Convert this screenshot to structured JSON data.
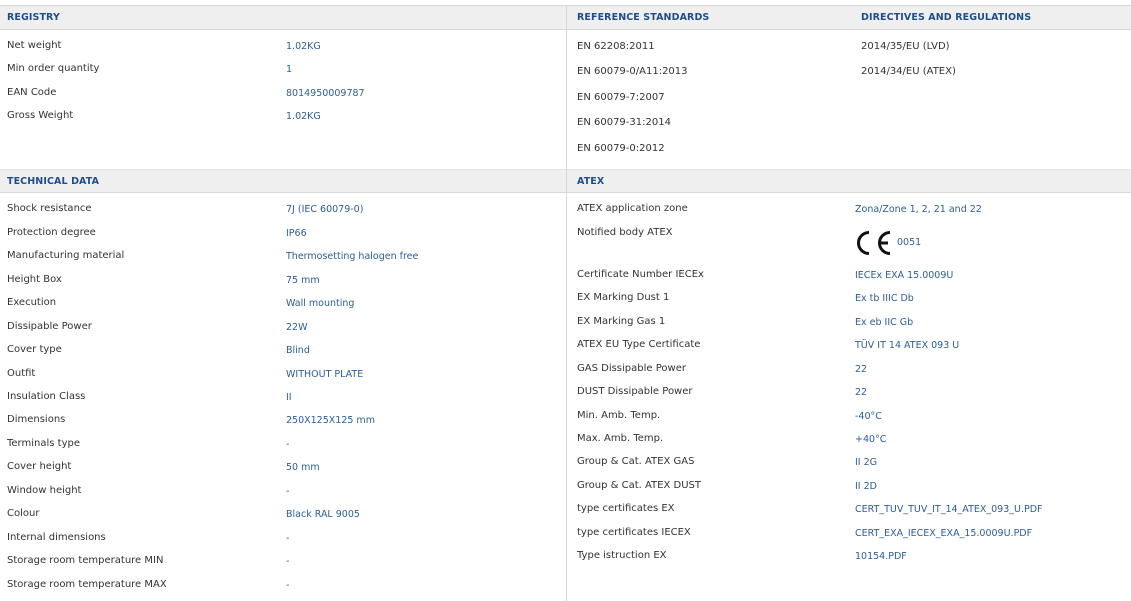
{
  "registry": {
    "title": "REGISTRY",
    "rows": [
      {
        "label": "Net weight",
        "value": "1.02KG"
      },
      {
        "label": "Min order quantity",
        "value": "1"
      },
      {
        "label": "EAN Code",
        "value": "8014950009787"
      },
      {
        "label": "Gross Weight",
        "value": "1.02KG"
      }
    ]
  },
  "reference_standards": {
    "title": "REFERENCE STANDARDS",
    "items": [
      "EN 62208:2011",
      "EN 60079-0/A11:2013",
      "EN 60079-7:2007",
      "EN 60079-31:2014",
      "EN 60079-0:2012"
    ]
  },
  "directives": {
    "title": "DIRECTIVES AND REGULATIONS",
    "items": [
      "2014/35/EU (LVD)",
      "2014/34/EU (ATEX)"
    ]
  },
  "technical_data": {
    "title": "TECHNICAL DATA",
    "rows": [
      {
        "label": "Shock resistance",
        "value": "7J (IEC 60079-0)"
      },
      {
        "label": "Protection degree",
        "value": "IP66"
      },
      {
        "label": "Manufacturing material",
        "value": "Thermosetting halogen free"
      },
      {
        "label": "Height Box",
        "value": "75 mm"
      },
      {
        "label": "Execution",
        "value": "Wall mounting"
      },
      {
        "label": "Dissipable Power",
        "value": "22W"
      },
      {
        "label": "Cover type",
        "value": "Blind"
      },
      {
        "label": "Outfit",
        "value": "WITHOUT PLATE"
      },
      {
        "label": "Insulation Class",
        "value": "II"
      },
      {
        "label": "Dimensions",
        "value": "250X125X125 mm"
      },
      {
        "label": "Terminals type",
        "value": "-"
      },
      {
        "label": "Cover height",
        "value": "50 mm"
      },
      {
        "label": "Window height",
        "value": "-"
      },
      {
        "label": "Colour",
        "value": "Black RAL 9005"
      },
      {
        "label": "Internal dimensions",
        "value": "-"
      },
      {
        "label": "Storage room temperature MIN",
        "value": "-"
      },
      {
        "label": "Storage room temperature MAX",
        "value": "-"
      }
    ]
  },
  "atex": {
    "title": "ATEX",
    "application_zone": {
      "label": "ATEX application zone",
      "value": "Zona/Zone 1, 2, 21 and 22"
    },
    "notified_body": {
      "label": "Notified body ATEX",
      "mark_text": "CE",
      "code": "0051"
    },
    "rows": [
      {
        "label": "Certificate Number IECEx",
        "value": "IECEx EXA 15.0009U"
      },
      {
        "label": "EX Marking Dust 1",
        "value": "Ex tb IIIC Db"
      },
      {
        "label": "EX Marking Gas 1",
        "value": "Ex eb IIC Gb"
      },
      {
        "label": "ATEX EU Type Certificate",
        "value": "TÜV IT 14 ATEX 093 U"
      },
      {
        "label": "GAS Dissipable Power",
        "value": "22"
      },
      {
        "label": "DUST Dissipable Power",
        "value": "22"
      },
      {
        "label": "Min. Amb. Temp.",
        "value": "-40°C"
      },
      {
        "label": "Max. Amb. Temp.",
        "value": "+40°C"
      },
      {
        "label": "Group & Cat. ATEX GAS",
        "value": "II 2G"
      },
      {
        "label": "Group & Cat. ATEX DUST",
        "value": "II 2D"
      },
      {
        "label": "type certificates EX",
        "value": "CERT_TUV_TUV_IT_14_ATEX_093_U.PDF"
      },
      {
        "label": "type certificates IECEX",
        "value": "CERT_EXA_IECEX_EXA_15.0009U.PDF"
      },
      {
        "label": "Type istruction EX",
        "value": "10154.PDF"
      }
    ]
  }
}
